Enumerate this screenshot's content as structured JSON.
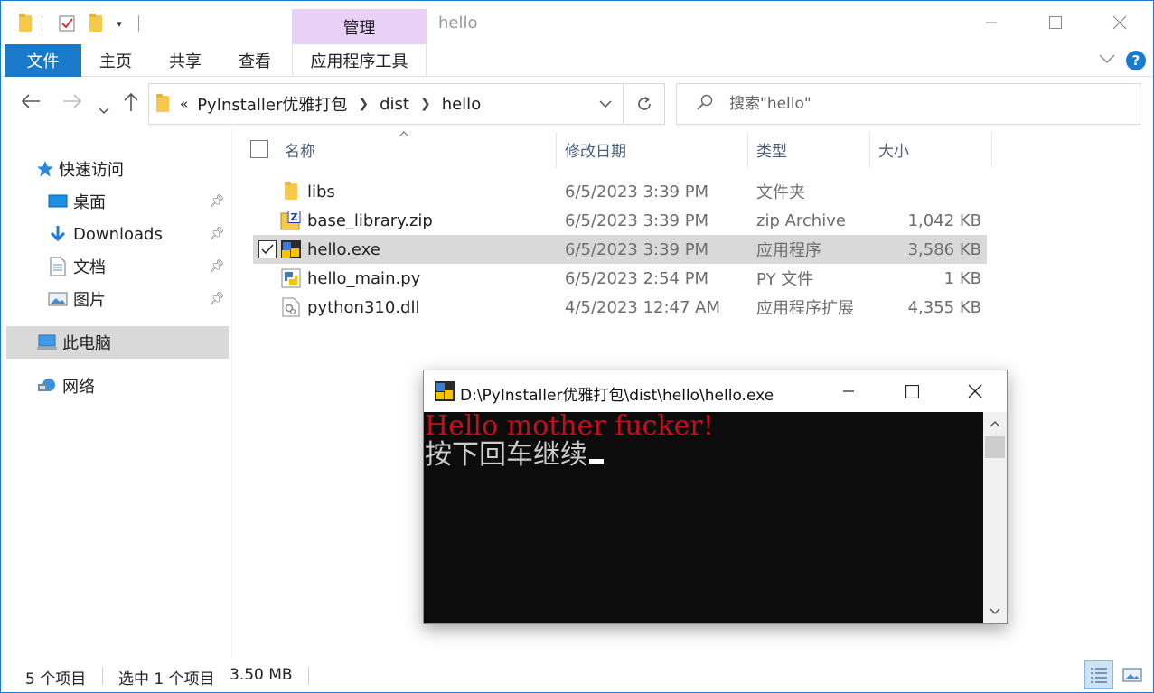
{
  "window": {
    "title": "hello",
    "contextual_tab_group": "管理",
    "accent_color": "#1979ca",
    "contextual_color": "#e8d0f7"
  },
  "ribbon": {
    "tabs": [
      "文件",
      "主页",
      "共享",
      "查看",
      "应用程序工具"
    ],
    "help_label": "?"
  },
  "address": {
    "overflow": "«",
    "crumbs": [
      "PyInstaller优雅打包",
      "dist",
      "hello"
    ]
  },
  "search": {
    "placeholder": "搜索\"hello\""
  },
  "nav": {
    "quick_access": "快速访问",
    "items": [
      {
        "label": "桌面",
        "icon": "desktop-icon",
        "pinned": true
      },
      {
        "label": "Downloads",
        "icon": "download-icon",
        "pinned": true
      },
      {
        "label": "文档",
        "icon": "document-icon",
        "pinned": true
      },
      {
        "label": "图片",
        "icon": "picture-icon",
        "pinned": true
      }
    ],
    "this_pc": "此电脑",
    "network": "网络"
  },
  "columns": {
    "name": "名称",
    "modified": "修改日期",
    "type": "类型",
    "size": "大小"
  },
  "files": [
    {
      "name": "libs",
      "modified": "6/5/2023 3:39 PM",
      "type": "文件夹",
      "size": "",
      "icon": "folder-icon",
      "selected": false
    },
    {
      "name": "base_library.zip",
      "modified": "6/5/2023 3:39 PM",
      "type": "zip Archive",
      "size": "1,042 KB",
      "icon": "zip-archive-icon",
      "selected": false
    },
    {
      "name": "hello.exe",
      "modified": "6/5/2023 3:39 PM",
      "type": "应用程序",
      "size": "3,586 KB",
      "icon": "python-exe-icon",
      "selected": true
    },
    {
      "name": "hello_main.py",
      "modified": "6/5/2023 2:54 PM",
      "type": "PY 文件",
      "size": "1 KB",
      "icon": "python-file-icon",
      "selected": false
    },
    {
      "name": "python310.dll",
      "modified": "4/5/2023 12:47 AM",
      "type": "应用程序扩展",
      "size": "4,355 KB",
      "icon": "dll-icon",
      "selected": false
    }
  ],
  "status": {
    "count": "5 个项目",
    "selection": "选中 1 个项目",
    "selection_size": "3.50 MB"
  },
  "console": {
    "title": "D:\\PyInstaller优雅打包\\dist\\hello\\hello.exe",
    "line1": "Hello mother fucker!",
    "line2": "按下回车继续",
    "line1_color": "#c50f1f",
    "line2_color": "#cccccc",
    "background": "#0c0c0c"
  }
}
